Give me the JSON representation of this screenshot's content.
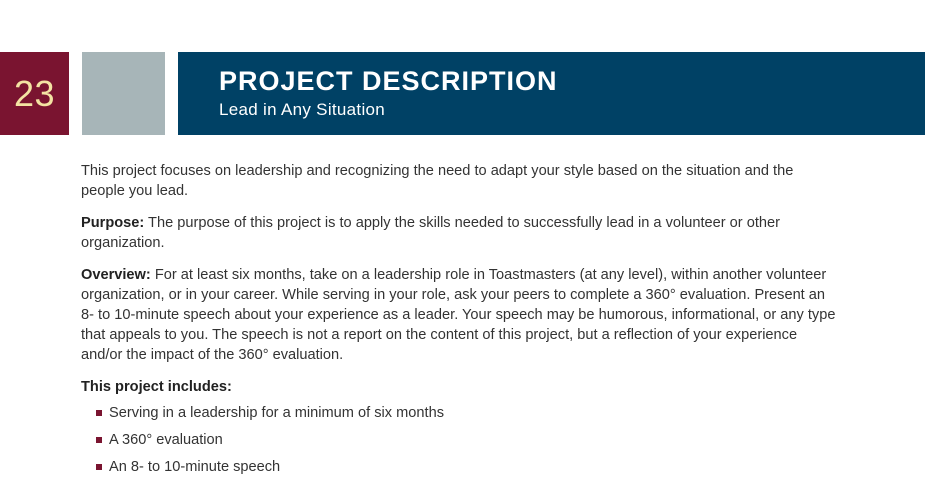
{
  "page_number": "23",
  "header": {
    "title": "PROJECT DESCRIPTION",
    "subtitle": "Lead in Any Situation"
  },
  "intro": "This project focuses on leadership and recognizing the need to adapt your style based on the situation and the people you lead.",
  "purpose": {
    "label": "Purpose:",
    "text": " The purpose of this project is to apply the skills needed to successfully lead in a volunteer or other organization."
  },
  "overview": {
    "label": "Overview:",
    "text": " For at least six months, take on a leadership role in Toastmasters (at any level), within another volunteer organization, or in your career. While serving in your role, ask your peers to complete a 360° evaluation. Present an 8- to 10-minute speech about your experience as a leader. Your speech may be humorous, informational, or any type that appeals to you. The speech is not a report on the content of this project, but a reflection of your experience and/or the impact of the 360° evaluation."
  },
  "includes": {
    "heading": "This project includes:",
    "items": [
      "Serving in a leadership for a minimum of six months",
      "A 360° evaluation",
      "An 8- to 10-minute speech"
    ]
  },
  "colors": {
    "brand_maroon": "#7a1430",
    "brand_blue": "#004165",
    "cool_gray": "#a7b5b8",
    "page_number_text": "#f4e3a3"
  }
}
